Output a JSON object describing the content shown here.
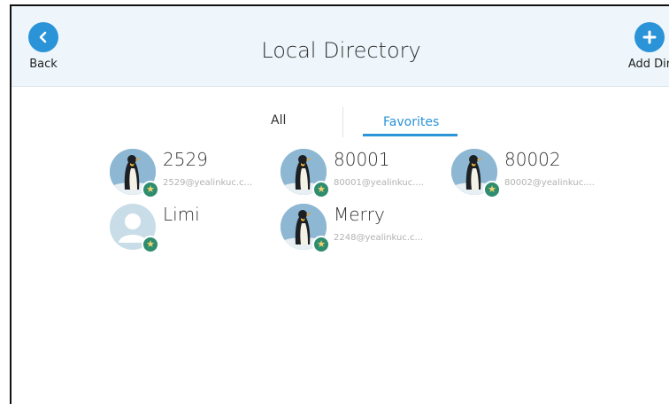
{
  "header": {
    "title": "Local Directory",
    "back_label": "Back",
    "add_label": "Add Dir",
    "back_icon": "chevron-left-icon",
    "add_icon": "plus-icon"
  },
  "tabs": [
    {
      "label": "All",
      "active": false
    },
    {
      "label": "Favorites",
      "active": true
    }
  ],
  "contacts": [
    {
      "name": "2529",
      "number": "2529@yealinkuc.c...",
      "avatar": "penguin",
      "favorite": true
    },
    {
      "name": "80001",
      "number": "80001@yealinkuc....",
      "avatar": "penguin",
      "favorite": true
    },
    {
      "name": "80002",
      "number": "80002@yealinkuc....",
      "avatar": "penguin",
      "favorite": true
    },
    {
      "name": "Limi",
      "number": "",
      "avatar": "person",
      "favorite": true
    },
    {
      "name": "Merry",
      "number": "2248@yealinkuc.c...",
      "avatar": "penguin",
      "favorite": true
    }
  ],
  "colors": {
    "accent": "#2b93d8",
    "header_bg": "#eef6fb",
    "star_badge": "#2e8d6f"
  }
}
